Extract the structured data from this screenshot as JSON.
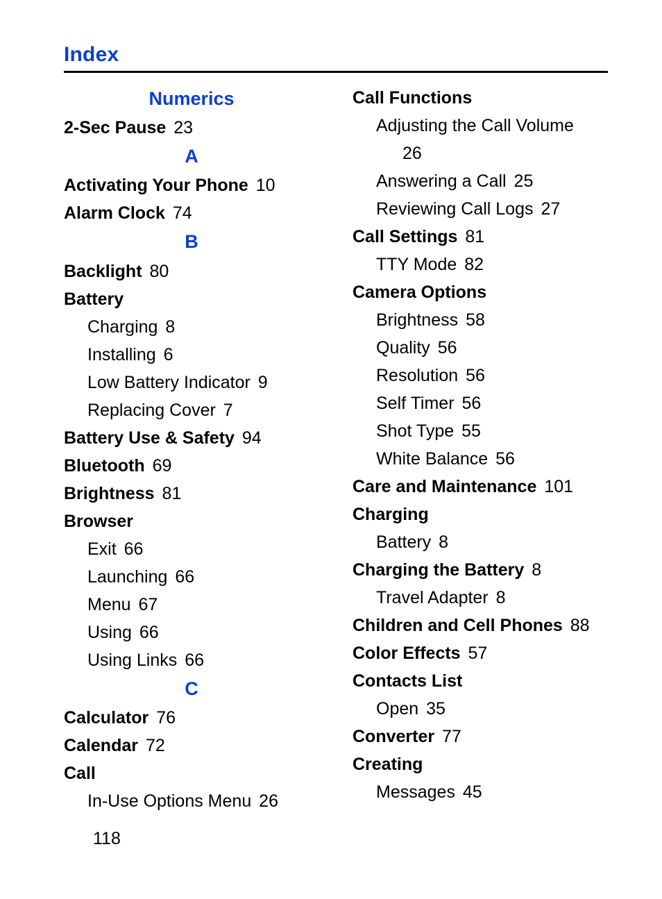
{
  "title": "Index",
  "page_number": "118",
  "sections": {
    "numerics": {
      "label": "Numerics"
    },
    "a": {
      "label": "A"
    },
    "b": {
      "label": "B"
    },
    "c": {
      "label": "C"
    }
  },
  "left": {
    "two_sec_pause": {
      "term": "2-Sec Pause",
      "page": "23"
    },
    "activating": {
      "term": "Activating Your Phone",
      "page": "10"
    },
    "alarm_clock": {
      "term": "Alarm Clock",
      "page": "74"
    },
    "backlight": {
      "term": "Backlight",
      "page": "80"
    },
    "battery": {
      "term": "Battery",
      "charging": {
        "label": "Charging",
        "page": "8"
      },
      "installing": {
        "label": "Installing",
        "page": "6"
      },
      "low_indicator": {
        "label": "Low Battery Indicator",
        "page": "9"
      },
      "replacing_cover": {
        "label": "Replacing Cover",
        "page": "7"
      }
    },
    "battery_use_safety": {
      "term": "Battery Use & Safety",
      "page": "94"
    },
    "bluetooth": {
      "term": "Bluetooth",
      "page": "69"
    },
    "brightness": {
      "term": "Brightness",
      "page": "81"
    },
    "browser": {
      "term": "Browser",
      "exit": {
        "label": "Exit",
        "page": "66"
      },
      "launching": {
        "label": "Launching",
        "page": "66"
      },
      "menu": {
        "label": "Menu",
        "page": "67"
      },
      "using": {
        "label": "Using",
        "page": "66"
      },
      "using_links": {
        "label": "Using Links",
        "page": "66"
      }
    },
    "calculator": {
      "term": "Calculator",
      "page": "76"
    },
    "calendar": {
      "term": "Calendar",
      "page": "72"
    },
    "call": {
      "term": "Call",
      "in_use_options": {
        "label": "In-Use Options Menu",
        "page": "26"
      }
    }
  },
  "right": {
    "call_functions": {
      "term": "Call Functions",
      "adjust_volume": {
        "label": "Adjusting the Call Volume",
        "page": "26"
      },
      "answering": {
        "label": "Answering a Call",
        "page": "25"
      },
      "reviewing_logs": {
        "label": "Reviewing Call Logs",
        "page": "27"
      }
    },
    "call_settings": {
      "term": "Call Settings",
      "page": "81",
      "tty_mode": {
        "label": "TTY Mode",
        "page": "82"
      }
    },
    "camera_options": {
      "term": "Camera Options",
      "brightness": {
        "label": "Brightness",
        "page": "58"
      },
      "quality": {
        "label": "Quality",
        "page": "56"
      },
      "resolution": {
        "label": "Resolution",
        "page": "56"
      },
      "self_timer": {
        "label": "Self Timer",
        "page": "56"
      },
      "shot_type": {
        "label": "Shot Type",
        "page": "55"
      },
      "white_balance": {
        "label": "White Balance",
        "page": "56"
      }
    },
    "care_maintenance": {
      "term": "Care and Maintenance",
      "page": "101"
    },
    "charging": {
      "term": "Charging",
      "battery": {
        "label": "Battery",
        "page": "8"
      }
    },
    "charging_the_battery": {
      "term": "Charging the Battery",
      "page": "8",
      "travel_adapter": {
        "label": "Travel Adapter",
        "page": "8"
      }
    },
    "children_cell": {
      "term": "Children and Cell Phones",
      "page": "88"
    },
    "color_effects": {
      "term": "Color Effects",
      "page": "57"
    },
    "contacts_list": {
      "term": "Contacts List",
      "open": {
        "label": "Open",
        "page": "35"
      }
    },
    "converter": {
      "term": "Converter",
      "page": "77"
    },
    "creating": {
      "term": "Creating",
      "messages": {
        "label": "Messages",
        "page": "45"
      }
    }
  }
}
